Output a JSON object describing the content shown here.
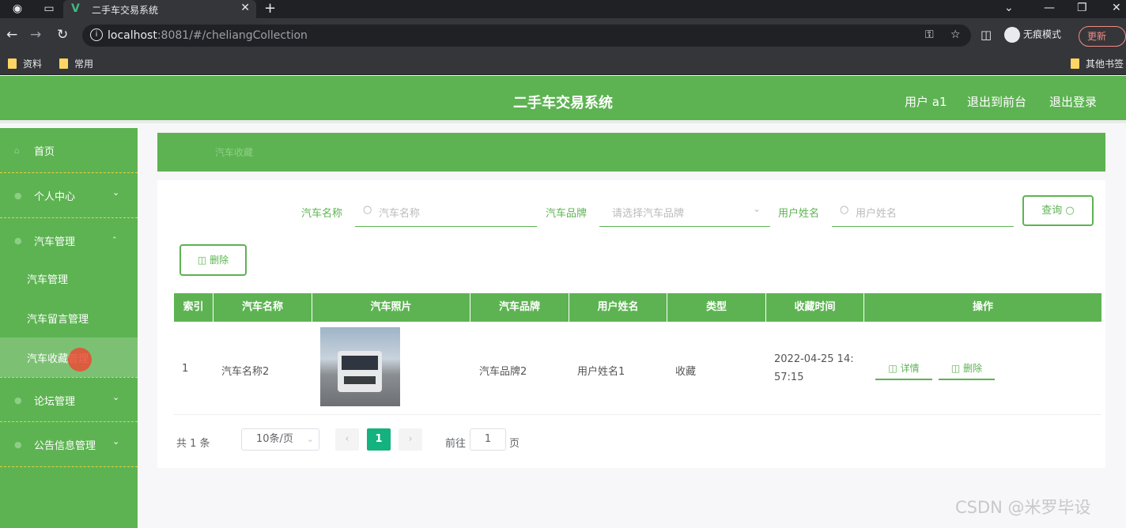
{
  "browser": {
    "tab_title": "二手车交易系统",
    "url_host": "localhost",
    "url_rest": ":8081/#/cheliangCollection",
    "incognito_label": "无痕模式",
    "update_label": "更新",
    "bookmarks": [
      "资料",
      "常用"
    ],
    "other_bookmarks": "其他书签"
  },
  "header": {
    "title": "二手车交易系统",
    "user": "用户 a1",
    "back_front": "退出到前台",
    "logout": "退出登录"
  },
  "sidebar": {
    "items": [
      {
        "label": "首页",
        "icon": "home-icon"
      },
      {
        "label": "个人中心",
        "icon": "user-icon"
      },
      {
        "label": "汽车管理",
        "icon": "car-icon"
      },
      {
        "label": "论坛管理",
        "icon": "forum-icon"
      },
      {
        "label": "公告信息管理",
        "icon": "notice-icon"
      }
    ],
    "subitems": [
      "汽车管理",
      "汽车留言管理",
      "汽车收藏管理"
    ]
  },
  "breadcrumb": "汽车收藏",
  "search": {
    "name_label": "汽车名称",
    "name_placeholder": "汽车名称",
    "brand_label": "汽车品牌",
    "brand_placeholder": "请选择汽车品牌",
    "user_label": "用户姓名",
    "user_placeholder": "用户姓名",
    "query_button": "查询"
  },
  "actions": {
    "delete_button": "删除"
  },
  "table": {
    "headers": [
      "索引",
      "汽车名称",
      "汽车照片",
      "汽车品牌",
      "用户姓名",
      "类型",
      "收藏时间",
      "操作"
    ],
    "rows": [
      {
        "index": "1",
        "name": "汽车名称2",
        "brand": "汽车品牌2",
        "user": "用户姓名1",
        "type": "收藏",
        "time_line1": "2022-04-25 14:",
        "time_line2": "57:15",
        "detail": "详情",
        "delete": "删除"
      }
    ]
  },
  "pagination": {
    "total": "共 1 条",
    "page_size": "10条/页",
    "current_page": "1",
    "goto_label": "前往",
    "goto_value": "1",
    "page_suffix": "页"
  },
  "watermark": "CSDN @米罗毕设",
  "colors": {
    "primary": "#5db352",
    "page_active": "#14b27e"
  }
}
